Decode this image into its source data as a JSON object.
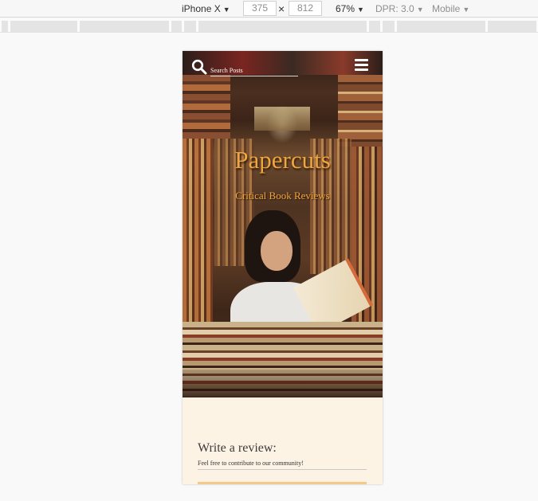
{
  "devtools": {
    "device": "iPhone X",
    "width": "375",
    "height": "812",
    "times": "×",
    "zoom": "67%",
    "dpr": "DPR: 3.0",
    "mode": "Mobile",
    "caret": "▼"
  },
  "site": {
    "search_placeholder": "Search Posts",
    "title": "Papercuts",
    "tagline": "Critical Book Reviews",
    "review_heading": "Write a review:",
    "review_text": "Feel free to contribute to our community!"
  },
  "colors": {
    "brand_orange": "#f0a63f",
    "page_bg": "#fdf3e4",
    "input_accent": "#f4c98a"
  },
  "icons": [
    "search-icon",
    "hamburger-menu-icon",
    "caret-down-icon"
  ]
}
